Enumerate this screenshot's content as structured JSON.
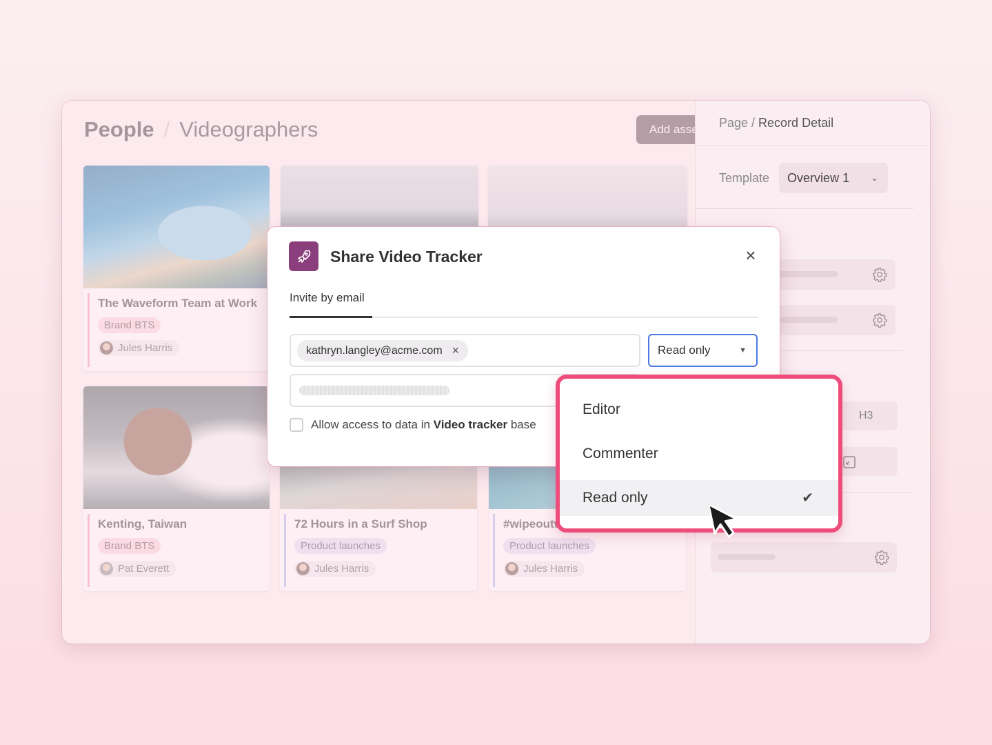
{
  "breadcrumb": {
    "root": "People",
    "separator": "/",
    "current": "Videographers"
  },
  "toolbar": {
    "add_label": "Add asset"
  },
  "cards": [
    {
      "title": "The Waveform Team at Work",
      "tag": "Brand BTS",
      "person": "Jules Harris"
    },
    {
      "title": "Kenting, Taiwan",
      "tag": "Brand BTS",
      "person": "Pat Everett"
    },
    {
      "title": "72 Hours in a Surf Shop",
      "tag": "Product launches",
      "person": "Jules Harris"
    },
    {
      "title": "#wipeoutw",
      "tag": "Product launches",
      "person": "Jules Harris"
    }
  ],
  "right_panel": {
    "breadcrumb_prefix": "Page / ",
    "breadcrumb_title": "Record Detail",
    "template_label": "Template",
    "template_value": "Overview 1",
    "heading_icon": "H3"
  },
  "modal": {
    "title": "Share Video Tracker",
    "tab": "Invite by email",
    "email_chip": "kathryn.langley@acme.com",
    "role_value": "Read only",
    "allow_prefix": "Allow access to data in",
    "allow_base": "Video tracker",
    "allow_suffix": "base"
  },
  "dropdown": {
    "options": [
      "Editor",
      "Commenter",
      "Read only"
    ],
    "selected": "Read only"
  },
  "colors": {
    "accent_pink": "#ee4d7c",
    "focus_blue": "#4a78e0",
    "icon_purple": "#8a3f7c"
  },
  "icons": [
    "rocket-icon",
    "close-icon",
    "chevron-down-icon",
    "gear-icon",
    "check-icon",
    "mouse-pointer-icon"
  ]
}
